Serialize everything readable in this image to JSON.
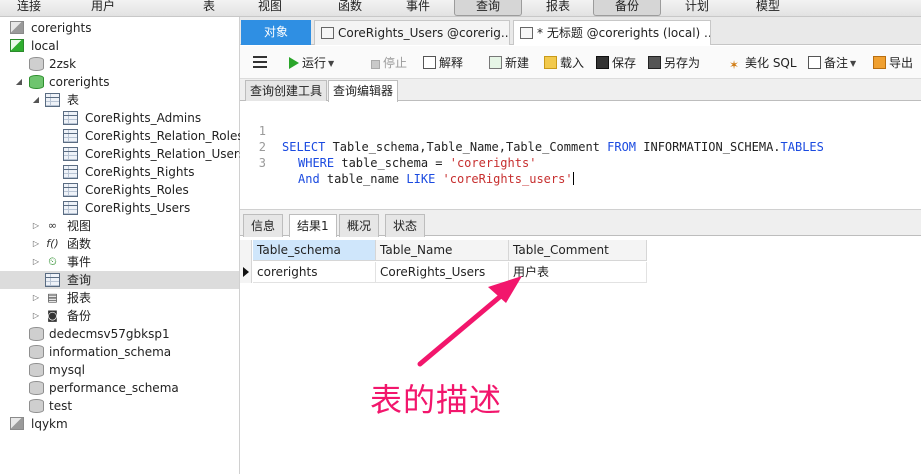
{
  "menubar": {
    "items": [
      {
        "label": "连接",
        "pressed": false
      },
      {
        "label": "用户",
        "pressed": false
      },
      {
        "label": "表",
        "pressed": false
      },
      {
        "label": "视图",
        "pressed": false
      },
      {
        "label": "函数",
        "pressed": false
      },
      {
        "label": "事件",
        "pressed": false
      },
      {
        "label": "查询",
        "pressed": true
      },
      {
        "label": "报表",
        "pressed": false
      },
      {
        "label": "备份",
        "pressed": true
      },
      {
        "label": "计划",
        "pressed": false
      },
      {
        "label": "模型",
        "pressed": false
      }
    ]
  },
  "sidebar": {
    "tree": [
      {
        "label": "corerights",
        "icon": "connection-icon"
      },
      {
        "label": "local",
        "icon": "connection-active-icon"
      },
      {
        "label": "2zsk",
        "icon": "database-icon"
      },
      {
        "label": "corerights",
        "icon": "database-open-icon"
      },
      {
        "label": "表",
        "icon": "tables-folder-icon"
      },
      {
        "label": "CoreRights_Admins",
        "icon": "table-icon"
      },
      {
        "label": "CoreRights_Relation_Roles",
        "icon": "table-icon"
      },
      {
        "label": "CoreRights_Relation_Users",
        "icon": "table-icon"
      },
      {
        "label": "CoreRights_Rights",
        "icon": "table-icon"
      },
      {
        "label": "CoreRights_Roles",
        "icon": "table-icon"
      },
      {
        "label": "CoreRights_Users",
        "icon": "table-icon"
      },
      {
        "label": "视图",
        "icon": "views-icon"
      },
      {
        "label": "函数",
        "icon": "functions-icon"
      },
      {
        "label": "事件",
        "icon": "events-icon"
      },
      {
        "label": "查询",
        "icon": "queries-icon"
      },
      {
        "label": "报表",
        "icon": "reports-icon"
      },
      {
        "label": "备份",
        "icon": "backup-icon"
      },
      {
        "label": "dedecmsv57gbksp1",
        "icon": "database-icon"
      },
      {
        "label": "information_schema",
        "icon": "database-icon"
      },
      {
        "label": "mysql",
        "icon": "database-icon"
      },
      {
        "label": "performance_schema",
        "icon": "database-icon"
      },
      {
        "label": "test",
        "icon": "database-icon"
      },
      {
        "label": "lqykm",
        "icon": "connection-icon"
      }
    ]
  },
  "tabs": {
    "objects": "对象",
    "query_tab_1": "CoreRights_Users @corerig...",
    "query_tab_2": "* 无标题 @corerights (local) ..."
  },
  "toolbar": {
    "run": "运行",
    "stop": "停止",
    "explain": "解释",
    "new": "新建",
    "load": "载入",
    "save": "保存",
    "save_as": "另存为",
    "beautify": "美化 SQL",
    "comment": "备注",
    "export": "导出"
  },
  "subtabs": {
    "builder": "查询创建工具",
    "editor": "查询编辑器"
  },
  "editor": {
    "lines": [
      {
        "no": "1"
      },
      {
        "no": "2"
      },
      {
        "no": "3"
      }
    ],
    "line1": {
      "kw1": "SELECT",
      "cols": " Table_schema,Table_Name,Table_Comment ",
      "kw2": "FROM",
      "src": " INFORMATION_SCHEMA.",
      "kw3": "TABLES"
    },
    "line2": {
      "kw1": "WHERE",
      "mid": " table_schema = ",
      "str": "'corerights'"
    },
    "line3": {
      "kw1": "And",
      "mid": " table_name ",
      "kw2": "LIKE",
      "sp": " ",
      "str": "'coreRights_users'"
    }
  },
  "result_tabs": {
    "info": "信息",
    "result1": "结果1",
    "profile": "概况",
    "status": "状态"
  },
  "grid": {
    "columns": [
      "Table_schema",
      "Table_Name",
      "Table_Comment"
    ],
    "rows": [
      [
        "corerights",
        "CoreRights_Users",
        "用户表"
      ]
    ]
  },
  "annotation": {
    "text": "表的描述",
    "color": "#f2166c"
  }
}
